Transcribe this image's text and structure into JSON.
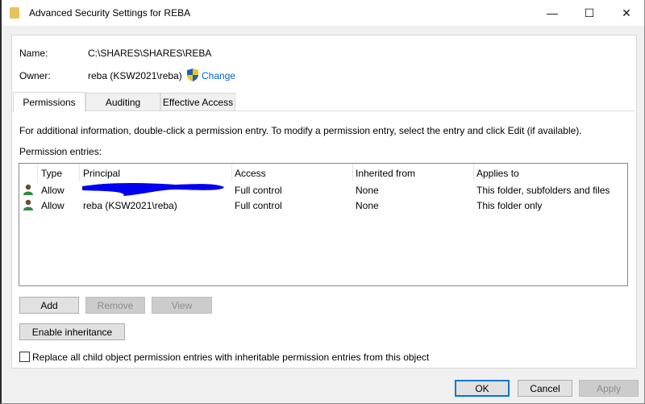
{
  "window": {
    "title": "Advanced Security Settings for REBA",
    "minimize": "—",
    "maximize": "☐",
    "close": "✕"
  },
  "name_label": "Name:",
  "name_value": "C:\\SHARES\\SHARES\\REBA",
  "owner_label": "Owner:",
  "owner_value": "reba (KSW2021\\reba)",
  "change_link": "Change",
  "tabs": [
    {
      "label": "Permissions",
      "active": true
    },
    {
      "label": "Auditing"
    },
    {
      "label": "Effective Access"
    }
  ],
  "info_text": "For additional information, double-click a permission entry. To modify a permission entry, select the entry and click Edit (if available).",
  "entries_label": "Permission entries:",
  "columns": [
    "Type",
    "Principal",
    "Access",
    "Inherited from",
    "Applies to"
  ],
  "rows": [
    {
      "type": "Allow",
      "principal": "",
      "access": "Full control",
      "inherited": "None",
      "applies": "This folder, subfolders and files"
    },
    {
      "type": "Allow",
      "principal": "reba (KSW2021\\reba)",
      "access": "Full control",
      "inherited": "None",
      "applies": "This folder only"
    }
  ],
  "buttons": {
    "add": "Add",
    "remove": "Remove",
    "view": "View",
    "enable_inheritance": "Enable inheritance",
    "ok": "OK",
    "cancel": "Cancel",
    "apply": "Apply"
  },
  "replace_checkbox": {
    "label": "Replace all child object permission entries with inheritable permission entries from this object",
    "checked": false
  }
}
